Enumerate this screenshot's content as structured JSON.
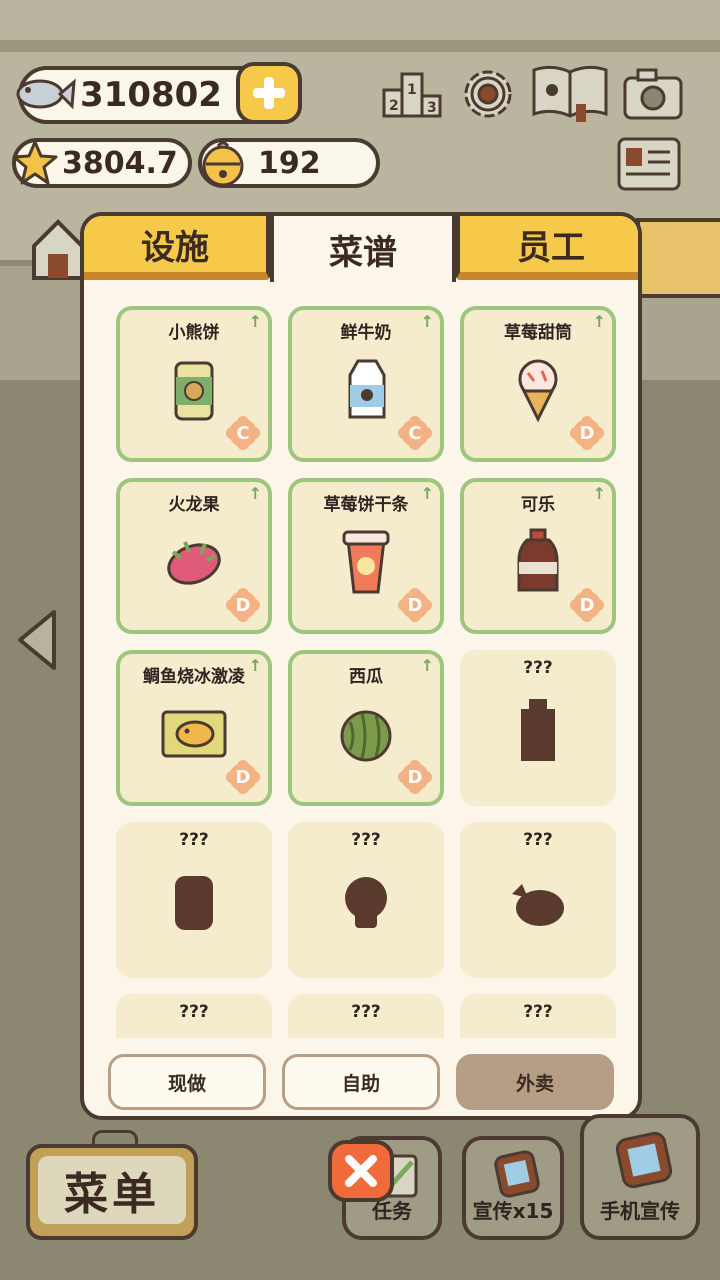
{
  "currency": {
    "fish": "310802",
    "stars": "3804.7",
    "bells": "192"
  },
  "tabs": [
    "设施",
    "菜谱",
    "员工"
  ],
  "active_tab": "菜谱",
  "recipes": [
    {
      "name": "小熊饼",
      "grade": "C",
      "locked": false,
      "icon": "bear-cookie-can-icon"
    },
    {
      "name": "鲜牛奶",
      "grade": "C",
      "locked": false,
      "icon": "milk-carton-icon"
    },
    {
      "name": "草莓甜筒",
      "grade": "D",
      "locked": false,
      "icon": "strawberry-cone-icon"
    },
    {
      "name": "火龙果",
      "grade": "D",
      "locked": false,
      "icon": "dragon-fruit-icon"
    },
    {
      "name": "草莓饼干条",
      "grade": "D",
      "locked": false,
      "icon": "strawberry-stick-cup-icon"
    },
    {
      "name": "可乐",
      "grade": "D",
      "locked": false,
      "icon": "cola-bottle-icon"
    },
    {
      "name": "鲷鱼烧冰激凌",
      "grade": "D",
      "locked": false,
      "icon": "taiyaki-icecream-icon"
    },
    {
      "name": "西瓜",
      "grade": "D",
      "locked": false,
      "icon": "watermelon-icon"
    },
    {
      "name": "???",
      "grade": "",
      "locked": true,
      "icon": "locked-bottle-silhouette-icon"
    },
    {
      "name": "???",
      "grade": "",
      "locked": true,
      "icon": "locked-jar-silhouette-icon"
    },
    {
      "name": "???",
      "grade": "",
      "locked": true,
      "icon": "locked-burger-silhouette-icon"
    },
    {
      "name": "???",
      "grade": "",
      "locked": true,
      "icon": "locked-chicken-silhouette-icon"
    },
    {
      "name": "???",
      "grade": "",
      "locked": true,
      "icon": "locked-silhouette-icon"
    },
    {
      "name": "???",
      "grade": "",
      "locked": true,
      "icon": "locked-silhouette-icon"
    },
    {
      "name": "???",
      "grade": "",
      "locked": true,
      "icon": "locked-silhouette-icon"
    }
  ],
  "modes": [
    "现做",
    "自助",
    "外卖"
  ],
  "selected_mode": "外卖",
  "bottom": {
    "menu_label": "菜单",
    "task_label": "任务",
    "promo_label": "宣传x15",
    "phone_promo_label": "手机宣传"
  },
  "colors": {
    "tab_yellow": "#f6c94a",
    "unlocked_border": "#9ec57e",
    "grade_badge": "#f3b283",
    "locked_silhouette": "#5a3a2c",
    "close_red": "#f06a3a"
  }
}
